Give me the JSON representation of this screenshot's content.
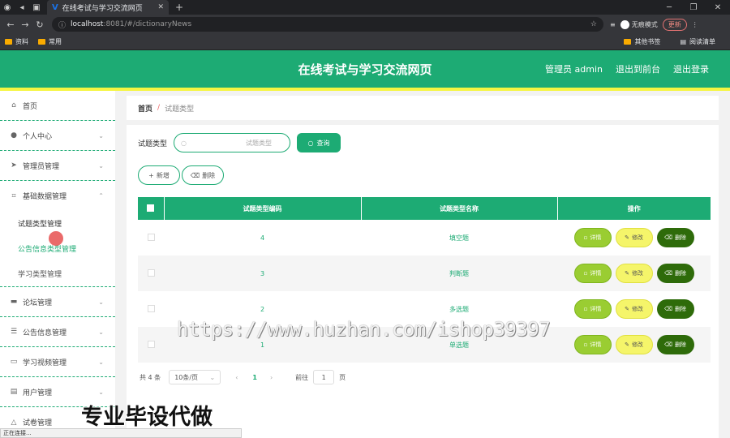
{
  "browser": {
    "tab_title": "在线考试与学习交流网页",
    "url_host": "localhost",
    "url_path": ":8081/#/dictionaryNews",
    "incognito_label": "无痕模式",
    "update_label": "更新",
    "bookmarks": [
      "资料",
      "常用"
    ],
    "bookmarks_right": [
      "其他书签",
      "阅读清单"
    ]
  },
  "header": {
    "title": "在线考试与学习交流网页",
    "user": "管理员 admin",
    "front_link": "退出到前台",
    "logout": "退出登录"
  },
  "sidebar": {
    "items": [
      {
        "label": "首页",
        "icon": "home-icon"
      },
      {
        "label": "个人中心",
        "icon": "user-icon"
      },
      {
        "label": "管理员管理",
        "icon": "send-icon"
      },
      {
        "label": "基础数据管理",
        "icon": "crop-icon"
      },
      {
        "label": "论坛管理",
        "icon": "forum-icon"
      },
      {
        "label": "公告信息管理",
        "icon": "list-icon"
      },
      {
        "label": "学习视频管理",
        "icon": "chat-icon"
      },
      {
        "label": "用户管理",
        "icon": "clipboard-icon"
      },
      {
        "label": "试卷管理",
        "icon": "bell-icon"
      }
    ],
    "subitems": [
      "试题类型管理",
      "公告信息类型管理",
      "学习类型管理"
    ]
  },
  "status_bar": "正在连接...",
  "breadcrumb": {
    "home": "首页",
    "sep": "/",
    "current": "试题类型"
  },
  "search": {
    "label": "试题类型",
    "placeholder": "试题类型",
    "button": "查询"
  },
  "actions": {
    "add": "新增",
    "delete": "删除"
  },
  "table": {
    "headers": [
      "试题类型编码",
      "试题类型名称",
      "操作"
    ],
    "rows": [
      {
        "code": "4",
        "name": "填空题"
      },
      {
        "code": "3",
        "name": "判断题"
      },
      {
        "code": "2",
        "name": "多选题"
      },
      {
        "code": "1",
        "name": "单选题"
      }
    ],
    "ops": {
      "detail": "详情",
      "edit": "修改",
      "delete": "删除"
    }
  },
  "pagination": {
    "total": "共 4 条",
    "page_size": "10条/页",
    "current": "1",
    "goto_label": "前往",
    "goto_value": "1",
    "page_unit": "页"
  },
  "watermark": "https://www.huzhan.com/ishop39397",
  "overlay": "专业毕设代做",
  "colors": {
    "primary": "#1dab74",
    "accent_yellow": "#f5f542",
    "detail": "#9acd32",
    "delete": "#2e6b0a"
  }
}
